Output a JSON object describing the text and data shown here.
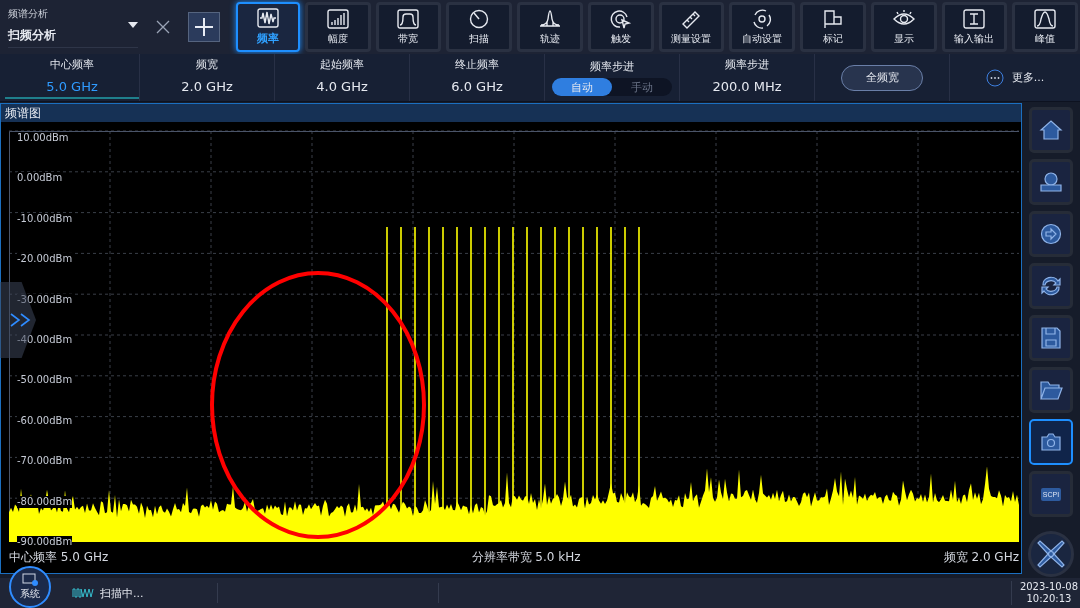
{
  "mode_selector": {
    "label": "频谱分析",
    "value": "扫频分析"
  },
  "menu_tabs": [
    {
      "kind": "wave",
      "label": "频率",
      "selected": true
    },
    {
      "kind": "bars",
      "label": "幅度",
      "selected": false
    },
    {
      "kind": "band",
      "label": "带宽",
      "selected": false
    },
    {
      "kind": "sweep",
      "label": "扫描",
      "selected": false
    },
    {
      "kind": "peak",
      "label": "轨迹",
      "selected": false
    },
    {
      "kind": "trigger",
      "label": "触发",
      "selected": false
    },
    {
      "kind": "ruler",
      "label": "测量设置",
      "selected": false
    },
    {
      "kind": "auto",
      "label": "自动设置",
      "selected": false
    },
    {
      "kind": "flag",
      "label": "标记",
      "selected": false
    },
    {
      "kind": "eye",
      "label": "显示",
      "selected": false
    },
    {
      "kind": "io",
      "label": "输入输出",
      "selected": false
    },
    {
      "kind": "hill",
      "label": "峰值",
      "selected": false
    }
  ],
  "params": [
    {
      "kind": "value",
      "label": "中心频率",
      "value": "5.0 GHz",
      "selected": true
    },
    {
      "kind": "value",
      "label": "频宽",
      "value": "2.0 GHz",
      "selected": false
    },
    {
      "kind": "value",
      "label": "起始频率",
      "value": "4.0 GHz",
      "selected": false
    },
    {
      "kind": "value",
      "label": "终止频率",
      "value": "6.0 GHz",
      "selected": false
    },
    {
      "kind": "toggle",
      "label": "频率步进",
      "options": [
        {
          "label": "自动",
          "selected": true
        },
        {
          "label": "手动",
          "selected": false
        }
      ]
    },
    {
      "kind": "value",
      "label": "频率步进",
      "value": "200.0 MHz",
      "selected": false
    },
    {
      "kind": "button",
      "label": "全频宽"
    },
    {
      "kind": "more",
      "label": "更多..."
    }
  ],
  "panel": {
    "title": "频谱图",
    "y_labels": [
      "10.00dBm",
      "0.00dBm",
      "-10.00dBm",
      "-20.00dBm",
      "-30.00dBm",
      "-40.00dBm",
      "-50.00dBm",
      "-60.00dBm",
      "-70.00dBm",
      "-80.00dBm",
      "-90.00dBm"
    ],
    "center_label": "中心频率 5.0 GHz",
    "rbw_label": "分辨率带宽 5.0 kHz",
    "span_label": "频宽 2.0 GHz"
  },
  "side_buttons": [
    {
      "kind": "home",
      "selected": false
    },
    {
      "kind": "recall",
      "selected": false
    },
    {
      "kind": "arrow",
      "selected": false
    },
    {
      "kind": "refresh",
      "selected": false
    },
    {
      "kind": "save",
      "selected": false
    },
    {
      "kind": "folder",
      "selected": false
    },
    {
      "kind": "camera",
      "selected": true
    },
    {
      "kind": "scpi",
      "label": "SCPI",
      "selected": false
    }
  ],
  "status": {
    "system_label": "系统",
    "scan_status": "扫描中...",
    "date": "2023-10-08",
    "time": "10:20:13"
  }
}
